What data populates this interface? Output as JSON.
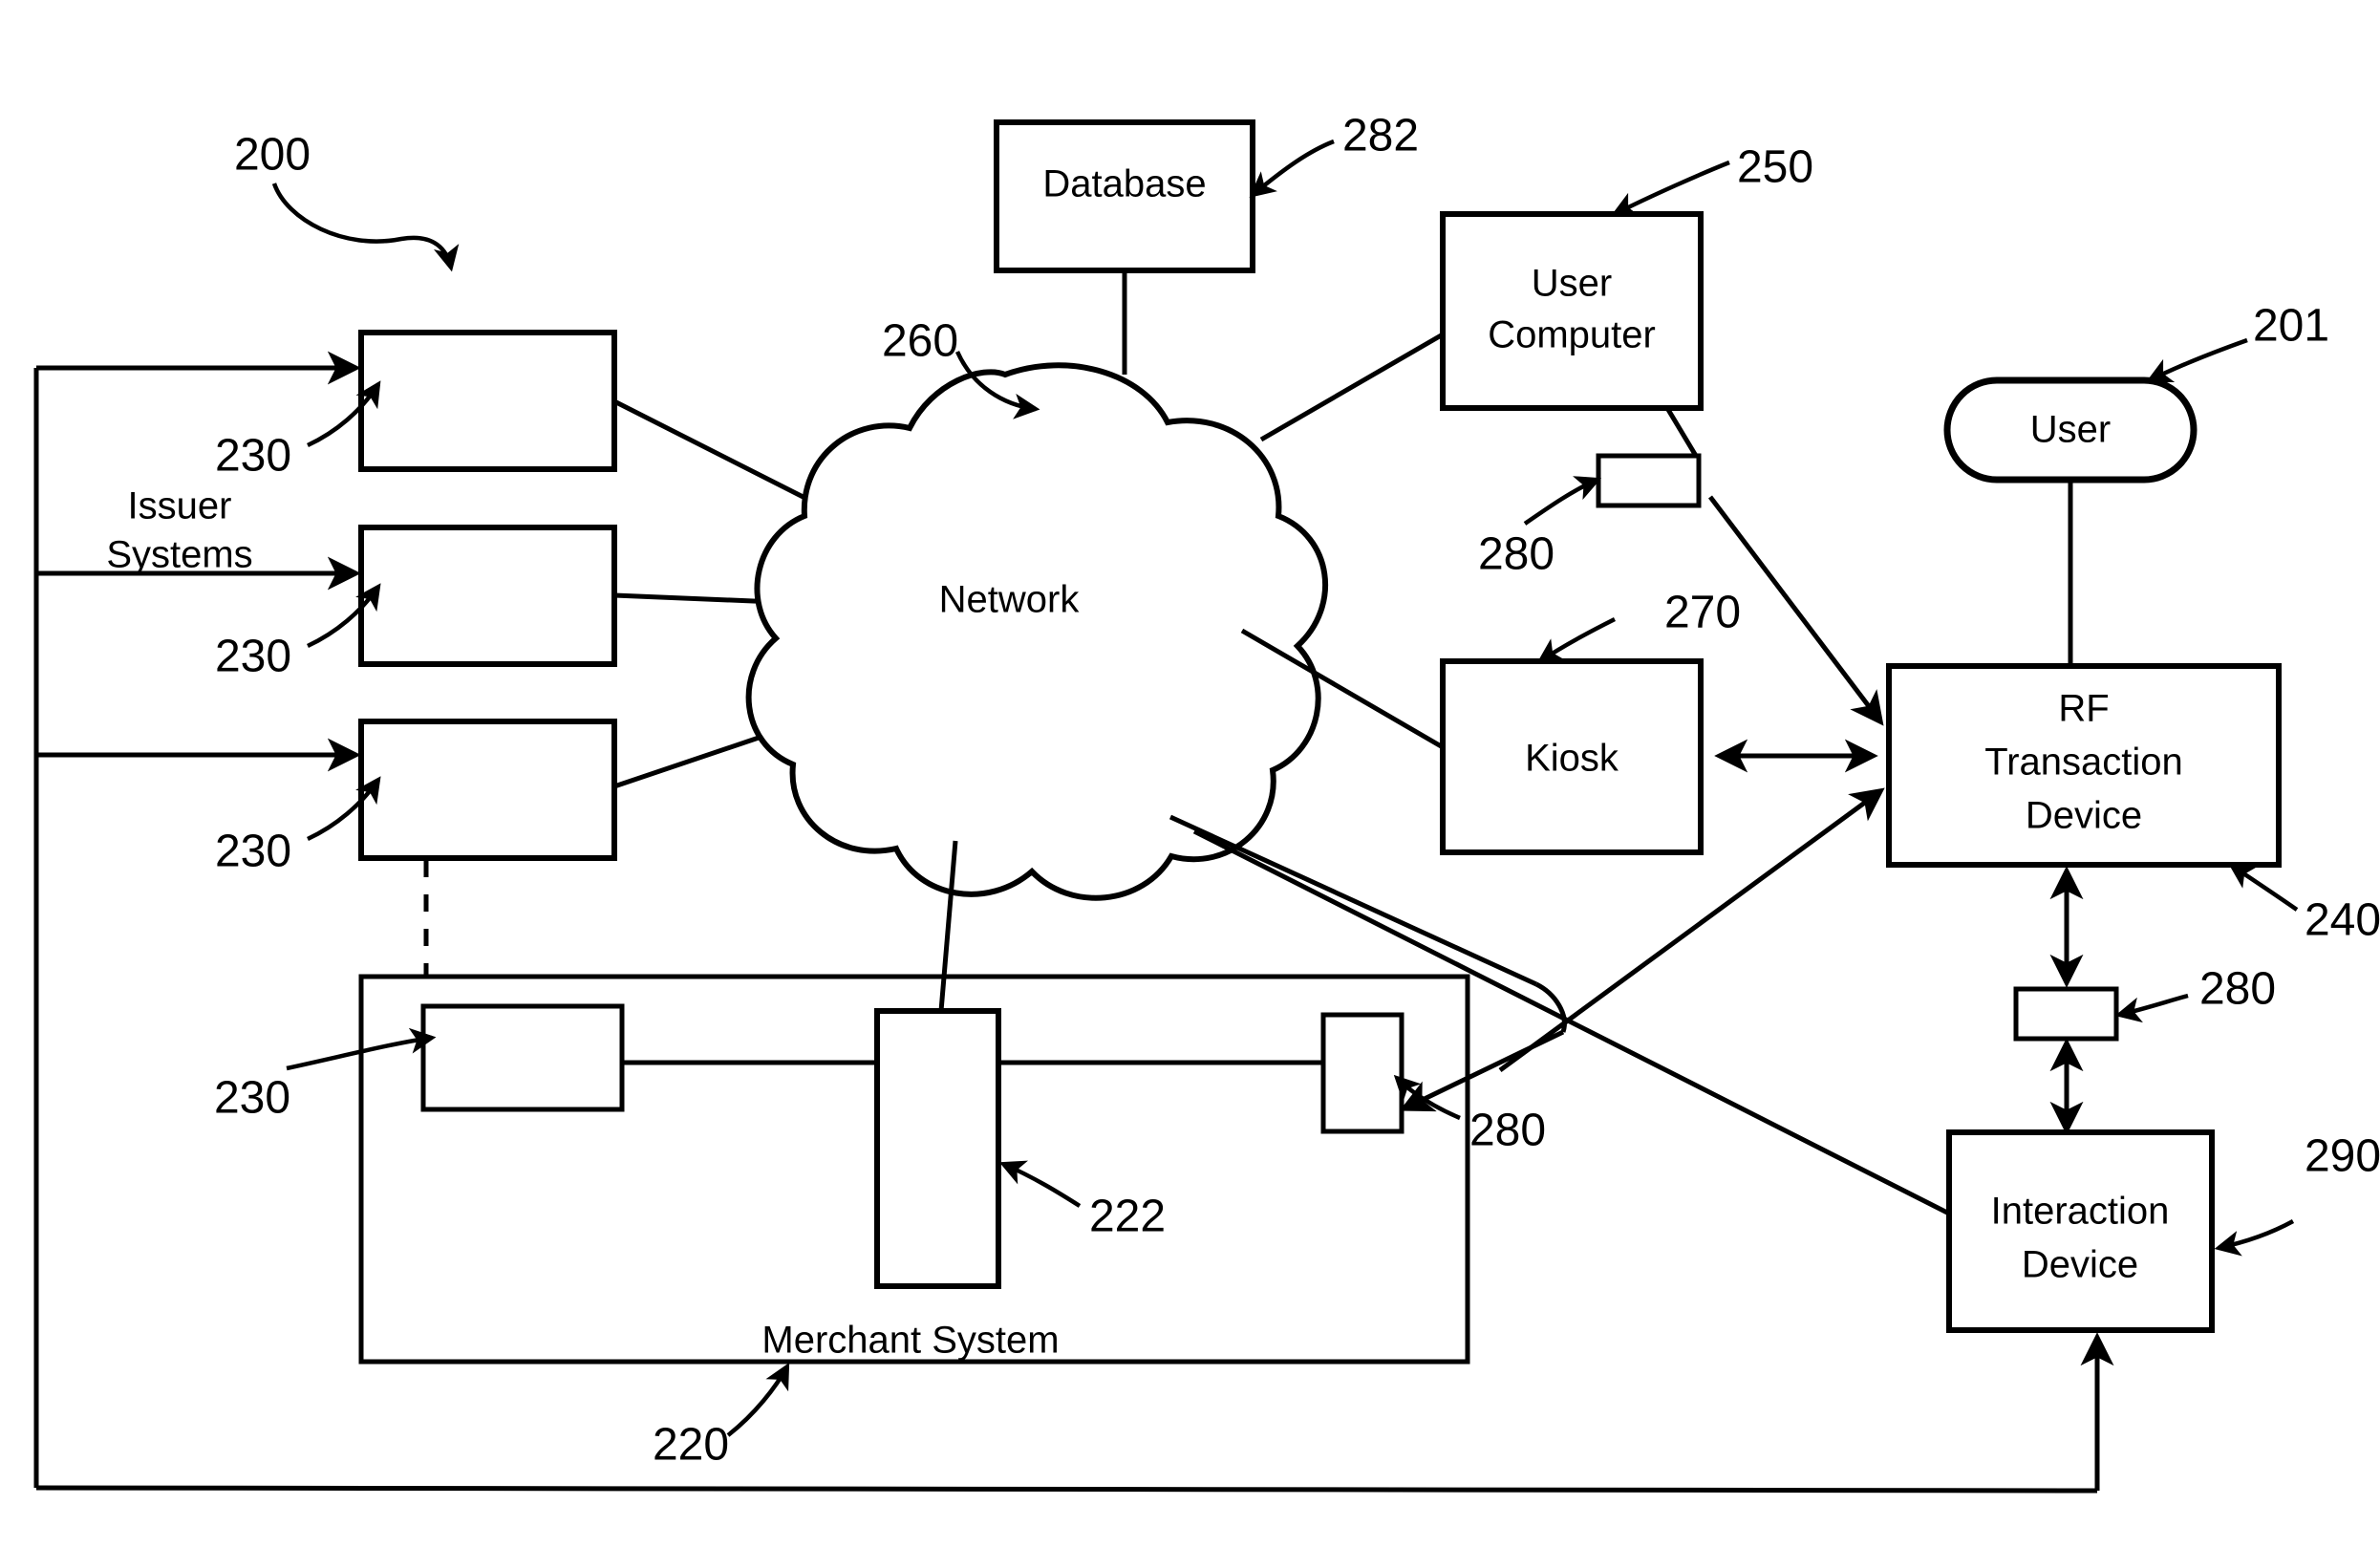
{
  "figure": {
    "id": "200",
    "type": "patent-system-block-diagram",
    "title": "",
    "background_color": "#ffffff",
    "line_color": "#000000"
  },
  "nodes": {
    "database": {
      "label": "Database",
      "ref": "282",
      "shape": "rectangle"
    },
    "network": {
      "label": "Network",
      "ref": "260",
      "shape": "cloud"
    },
    "user_computer": {
      "label": "User\nComputer",
      "line1": "User",
      "line2": "Computer",
      "ref": "250",
      "shape": "rectangle"
    },
    "kiosk": {
      "label": "Kiosk",
      "ref": "270",
      "shape": "rectangle"
    },
    "user": {
      "label": "User",
      "ref": "201",
      "shape": "rounded-pill"
    },
    "rf_transaction_device": {
      "line1": "RF",
      "line2": "Transaction",
      "line3": "Device",
      "ref": "240",
      "shape": "rectangle"
    },
    "interaction_device": {
      "line1": "Interaction",
      "line2": "Device",
      "ref": "290",
      "shape": "rectangle"
    },
    "merchant_system": {
      "label": "Merchant System",
      "ref": "220",
      "shape": "rectangle-container"
    },
    "merchant_inner_222": {
      "label": "",
      "ref": "222",
      "shape": "rectangle"
    },
    "merchant_inner_230": {
      "label": "",
      "ref": "230",
      "shape": "rectangle"
    },
    "merchant_reader_280": {
      "label": "",
      "ref": "280",
      "shape": "rectangle"
    },
    "issuer_systems_label": {
      "line1": "Issuer",
      "line2": "Systems"
    },
    "issuer_system_1": {
      "label": "",
      "ref": "230",
      "shape": "rectangle"
    },
    "issuer_system_2": {
      "label": "",
      "ref": "230",
      "shape": "rectangle"
    },
    "issuer_system_3": {
      "label": "",
      "ref": "230",
      "shape": "rectangle"
    },
    "reader_near_user_computer": {
      "label": "",
      "ref": "280",
      "shape": "rectangle"
    },
    "reader_near_interaction_device": {
      "label": "",
      "ref": "280",
      "shape": "rectangle"
    }
  },
  "reference_numerals": {
    "figure": "200",
    "user": "201",
    "merchant_system": "220",
    "merchant_terminal": "222",
    "issuer_system_a": "230",
    "issuer_system_b": "230",
    "issuer_system_c": "230",
    "merchant_issuer": "230",
    "rf_transaction_device": "240",
    "user_computer": "250",
    "network": "260",
    "kiosk": "270",
    "reader_user_computer": "280",
    "reader_merchant": "280",
    "reader_interaction_device": "280",
    "database": "282",
    "interaction_device": "290"
  },
  "text_labels": {
    "database": "Database",
    "network": "Network",
    "user_computer_line1": "User",
    "user_computer_line2": "Computer",
    "kiosk": "Kiosk",
    "user": "User",
    "rf_line1": "RF",
    "rf_line2": "Transaction",
    "rf_line3": "Device",
    "interaction_line1": "Interaction",
    "interaction_line2": "Device",
    "merchant_system": "Merchant System",
    "issuer_line1": "Issuer",
    "issuer_line2": "Systems"
  }
}
